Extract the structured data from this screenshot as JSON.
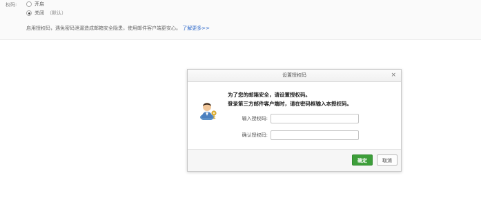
{
  "setting": {
    "label": "权码:",
    "options": [
      {
        "label": "开启",
        "note": "",
        "checked": false
      },
      {
        "label": "关闭",
        "note": "（默认）",
        "checked": true
      }
    ],
    "description": "启用授权码，遇免密码泄漏造成邮箱安全隐患，使用邮件客户端更安心。",
    "learn_more": "了解更多>>"
  },
  "dialog": {
    "title": "设置授权码",
    "close": "×",
    "message_line1": "为了您的邮箱安全，请设置授权码。",
    "message_line2": "登录第三方邮件客户端时，请在密码框输入本授权码。",
    "fields": [
      {
        "label": "输入授权码:",
        "value": ""
      },
      {
        "label": "确认授权码:",
        "value": ""
      }
    ],
    "ok_label": "确定",
    "cancel_label": "取消",
    "colors": {
      "ok": "#3d9e3a"
    },
    "icon": "user-key-icon"
  }
}
